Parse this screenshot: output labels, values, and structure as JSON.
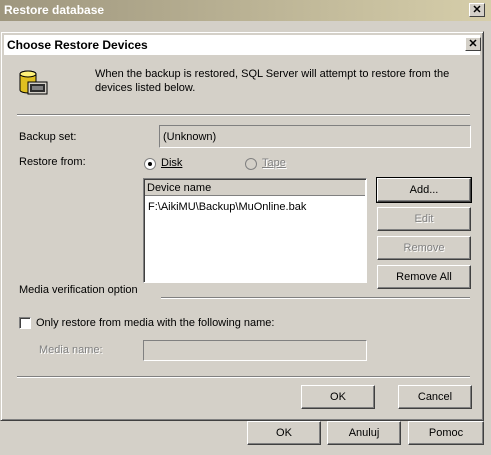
{
  "outer_window": {
    "title": "Restore database",
    "close_glyph": "✕",
    "buttons": {
      "ok": "OK",
      "cancel": "Anuluj",
      "help": "Pomoc"
    }
  },
  "dialog": {
    "title": "Choose Restore Devices",
    "close_glyph": "✕",
    "info_icon": "database-backup-icon",
    "info_text_line1": "When the backup is restored, SQL Server will attempt to restore from the",
    "info_text_line2": "devices listed below.",
    "backup_set_label": "Backup set:",
    "backup_set_value": "(Unknown)",
    "restore_from_label": "Restore from:",
    "restore_options": [
      {
        "label": "Disk",
        "selected": true,
        "enabled": true
      },
      {
        "label": "Tape",
        "selected": false,
        "enabled": false
      }
    ],
    "device_list": {
      "header": "Device name",
      "items": [
        "F:\\AikiMU\\Backup\\MuOnline.bak"
      ]
    },
    "device_buttons": {
      "add": "Add...",
      "edit": "Edit",
      "remove": "Remove",
      "remove_all": "Remove All"
    },
    "media_verification_label": "Media verification option",
    "only_restore_checkbox": {
      "label": "Only restore from media with the following name:",
      "checked": false
    },
    "media_name_label": "Media name:",
    "media_name_value": "",
    "ok": "OK",
    "cancel": "Cancel"
  }
}
